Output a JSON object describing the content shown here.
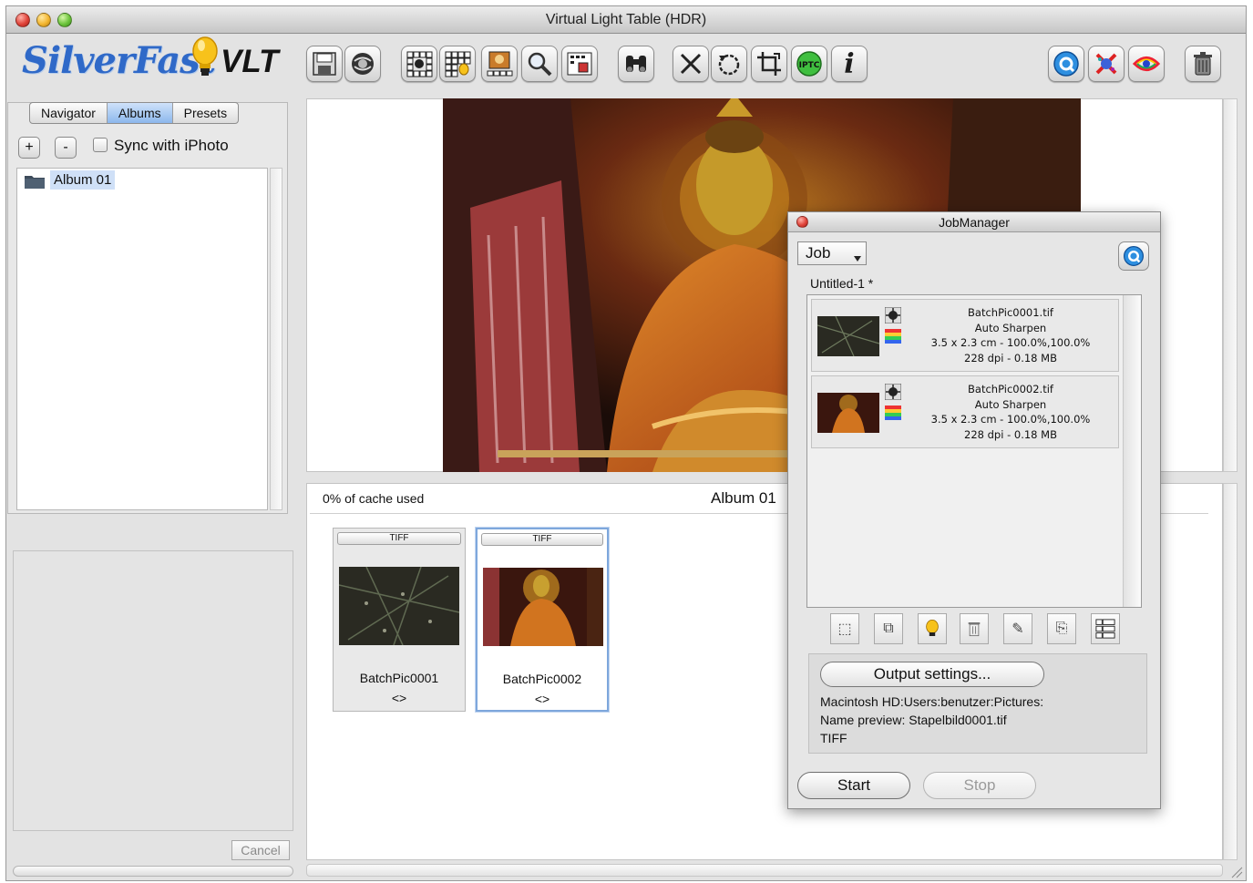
{
  "window": {
    "title": "Virtual Light Table (HDR)"
  },
  "logo": {
    "brand": "SilverFast",
    "product": "VLT"
  },
  "toolbar": {
    "buttons": [
      {
        "icon": "save-icon"
      },
      {
        "icon": "globe-icon"
      },
      {
        "icon": "grid-view-icon"
      },
      {
        "icon": "grid-light-icon"
      },
      {
        "icon": "lighttable-icon"
      },
      {
        "icon": "magnifier-icon"
      },
      {
        "icon": "compare-icon"
      },
      {
        "icon": "binoculars-icon"
      },
      {
        "icon": "close-x-icon"
      },
      {
        "icon": "rotate-icon"
      },
      {
        "icon": "crop-icon"
      },
      {
        "icon": "iptc-icon"
      },
      {
        "icon": "info-icon"
      },
      {
        "icon": "help-icon"
      },
      {
        "icon": "color-correct-icon"
      },
      {
        "icon": "hdr-eye-icon"
      },
      {
        "icon": "trash-icon"
      }
    ],
    "iptc_label": "IPTC",
    "info_label": "i"
  },
  "sidebar": {
    "tabs": [
      "Navigator",
      "Albums",
      "Presets"
    ],
    "active_tab": "Albums",
    "add_label": "+",
    "remove_label": "-",
    "sync_label": "Sync with iPhoto",
    "albums": [
      "Album 01"
    ],
    "cancel_label": "Cancel"
  },
  "album": {
    "cache_text": "0% of cache used",
    "title": "Album 01",
    "thumbnails": [
      {
        "format": "TIFF",
        "name": "BatchPic0001",
        "sub": "<>",
        "selected": false
      },
      {
        "format": "TIFF",
        "name": "BatchPic0002",
        "sub": "<>",
        "selected": true
      }
    ]
  },
  "jobmanager": {
    "title": "JobManager",
    "select_value": "Job",
    "job_name": "Untitled-1 *",
    "jobs": [
      {
        "file": "BatchPic0001.tif",
        "filter": "Auto Sharpen",
        "size": "3.5 x 2.3 cm - 100.0%,100.0%",
        "res": "228 dpi - 0.18 MB"
      },
      {
        "file": "BatchPic0002.tif",
        "filter": "Auto Sharpen",
        "size": "3.5 x 2.3 cm - 100.0%,100.0%",
        "res": "228 dpi - 0.18 MB"
      }
    ],
    "tools": [
      {
        "icon": "new-job-icon"
      },
      {
        "icon": "add-images-icon"
      },
      {
        "icon": "light-icon"
      },
      {
        "icon": "trash-icon"
      },
      {
        "icon": "edit-icon"
      },
      {
        "icon": "copy-icon"
      },
      {
        "icon": "batch-grid-icon"
      }
    ],
    "output_button": "Output settings...",
    "output_path": "Macintosh HD:Users:benutzer:Pictures:",
    "name_preview": "Name preview: Stapelbild0001.tif",
    "format": "TIFF",
    "start_label": "Start",
    "stop_label": "Stop"
  }
}
